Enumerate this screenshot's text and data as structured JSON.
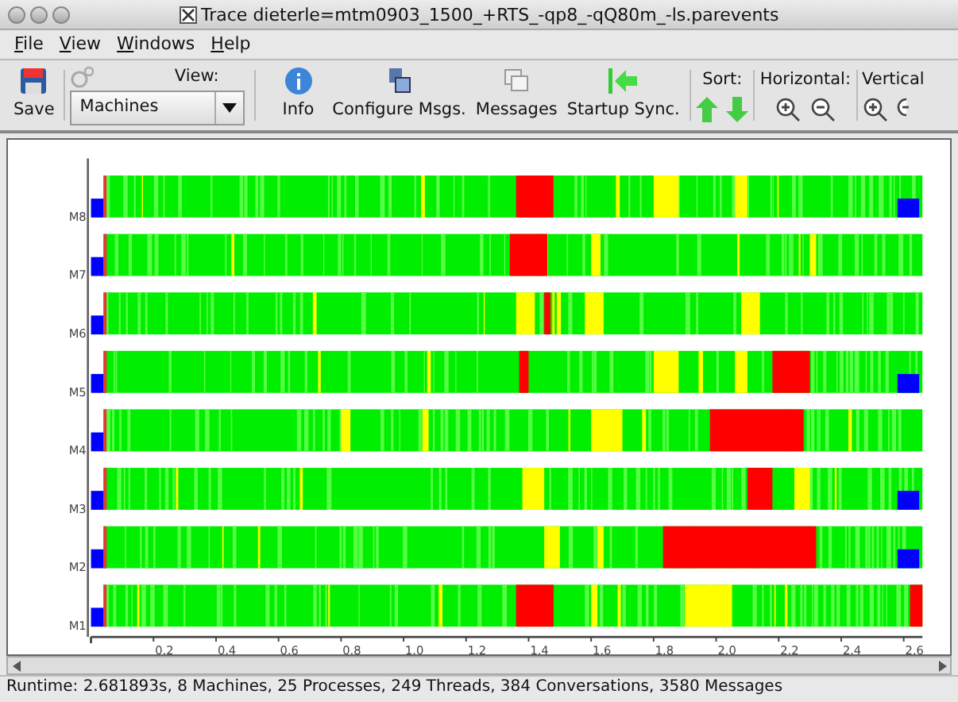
{
  "window": {
    "title": "Trace dieterle=mtm0903_1500_+RTS_-qp8_-qQ80m_-ls.parevents"
  },
  "menu": [
    "File",
    "View",
    "Windows",
    "Help"
  ],
  "toolbar": {
    "save": "Save",
    "view_label": "View:",
    "view_value": "Machines",
    "info": "Info",
    "configure": "Configure Msgs.",
    "messages": "Messages",
    "startup": "Startup Sync.",
    "sort_label": "Sort:",
    "horizontal_label": "Horizontal:",
    "vertical_label": "Vertical"
  },
  "timeline": {
    "machines": [
      "M8",
      "M7",
      "M6",
      "M5",
      "M4",
      "M3",
      "M2",
      "M1"
    ],
    "ticks": [
      "0.2",
      "0.4",
      "0.6",
      "0.8",
      "1.0",
      "1.2",
      "1.4",
      "1.6",
      "1.8",
      "2.0",
      "2.2",
      "2.4",
      "2.6"
    ]
  },
  "status_bar": "Runtime: 2.681893s, 8 Machines, 25 Processes, 249 Threads, 384 Conversations, 3580 Messages"
}
